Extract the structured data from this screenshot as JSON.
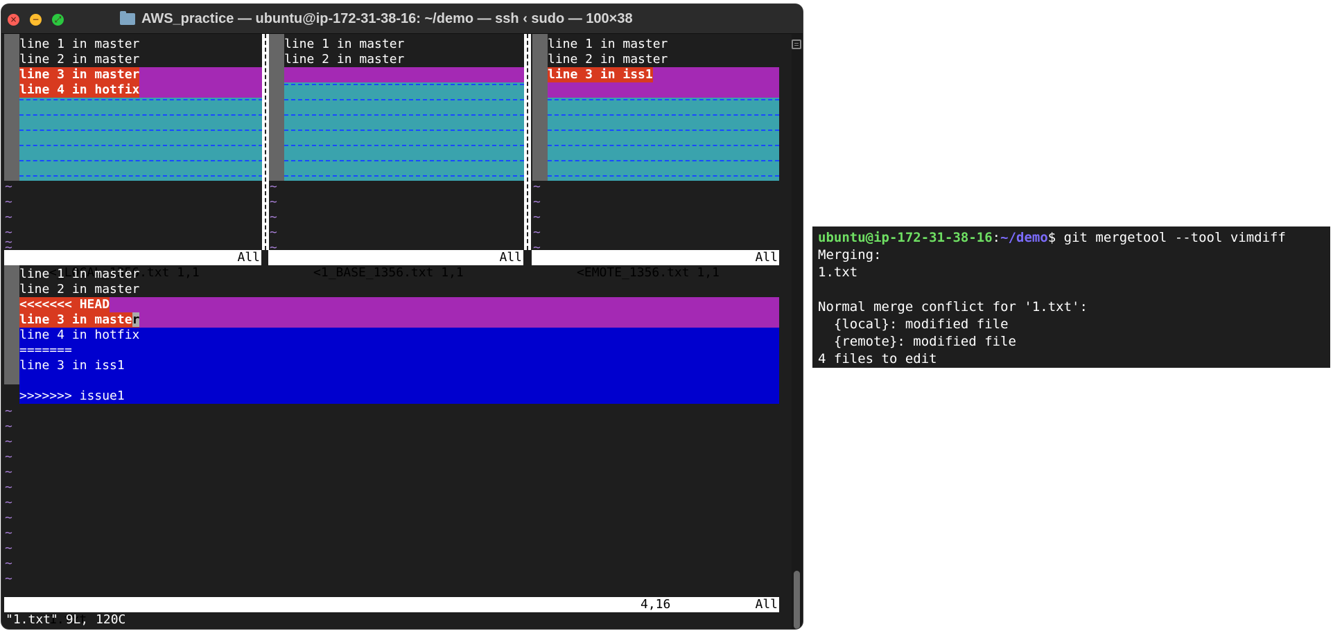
{
  "window": {
    "title": "AWS_practice — ubuntu@ip-172-31-38-16: ~/demo — ssh ‹ sudo — 100×38",
    "close_glyph": "×",
    "min_glyph": "−",
    "max_glyph": "⤢"
  },
  "vim": {
    "local_lines": [
      "line 1 in master",
      "line 2 in master",
      "line 3 in master",
      "line 4 in hotfix"
    ],
    "base_lines": [
      "line 1 in master",
      "line 2 in master"
    ],
    "remote_lines": [
      "line 1 in master",
      "line 2 in master",
      "line 3 in iss1"
    ],
    "merged_lines": [
      "line 1 in master",
      "line 2 in master",
      "<<<<<<< HEAD",
      "line 3 in maste",
      "r",
      "line 4 in hotfix",
      "=======",
      "line 3 in iss1",
      "",
      ">>>>>>> issue1"
    ],
    "tilde": "~",
    "status_local": {
      "file": "<_LOCAL_1356.txt 1,1",
      "pos": "All"
    },
    "status_base": {
      "file": "<1_BASE_1356.txt 1,1",
      "pos": "All"
    },
    "status_remote": {
      "file": "<EMOTE_1356.txt 1,1",
      "pos": "All"
    },
    "status_merged": {
      "file": "1.txt",
      "cursor": "4,16",
      "pos": "All"
    },
    "cmdline": "\"1.txt\" 9L, 120C"
  },
  "terminal2": {
    "prompt_user": "ubuntu@ip-172-31-38-16",
    "prompt_colon": ":",
    "prompt_path": "~/demo",
    "prompt_cmd": "$ git mergetool --tool vimdiff",
    "lines": [
      "Merging:",
      "1.txt",
      "",
      "Normal merge conflict for '1.txt':",
      "  {local}: modified file",
      "  {remote}: modified file",
      "4 files to edit"
    ]
  },
  "colors": {
    "diff_change": "#a429b4",
    "diff_text": "#d83a1f",
    "diff_filler": "#3aa3ad",
    "conflict_block": "#0000ce",
    "prompt_green": "#6fe063",
    "prompt_blue": "#7c6cff"
  }
}
